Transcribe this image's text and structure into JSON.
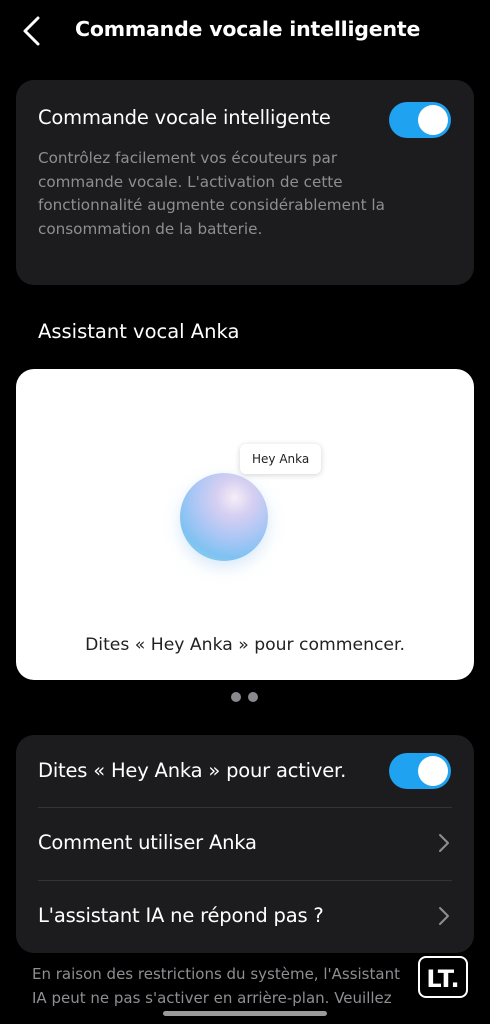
{
  "header": {
    "title": "Commande vocale intelligente"
  },
  "smart_voice": {
    "label": "Commande vocale intelligente",
    "enabled": true,
    "description": "Contrôlez facilement vos écouteurs par commande vocale. L'activation de cette fonctionnalité augmente considérablement la consommation de la batterie."
  },
  "assistant": {
    "section_title": "Assistant vocal Anka",
    "bubble": "Hey Anka",
    "caption": "Dites « Hey Anka » pour commencer.",
    "page_count": 2
  },
  "settings": {
    "items": [
      {
        "label": "Dites « Hey Anka » pour activer.",
        "type": "toggle",
        "enabled": true
      },
      {
        "label": "Comment utiliser Anka",
        "type": "link"
      },
      {
        "label": "L'assistant IA ne répond pas ?",
        "type": "link"
      }
    ]
  },
  "footnote": "En raison des restrictions du système, l'Assistant IA peut ne pas s'activer en arrière-plan. Veuillez",
  "watermark": {
    "text": "LT."
  },
  "colors": {
    "accent": "#1fa2f0",
    "card": "#1c1c1e",
    "background": "#000000"
  }
}
